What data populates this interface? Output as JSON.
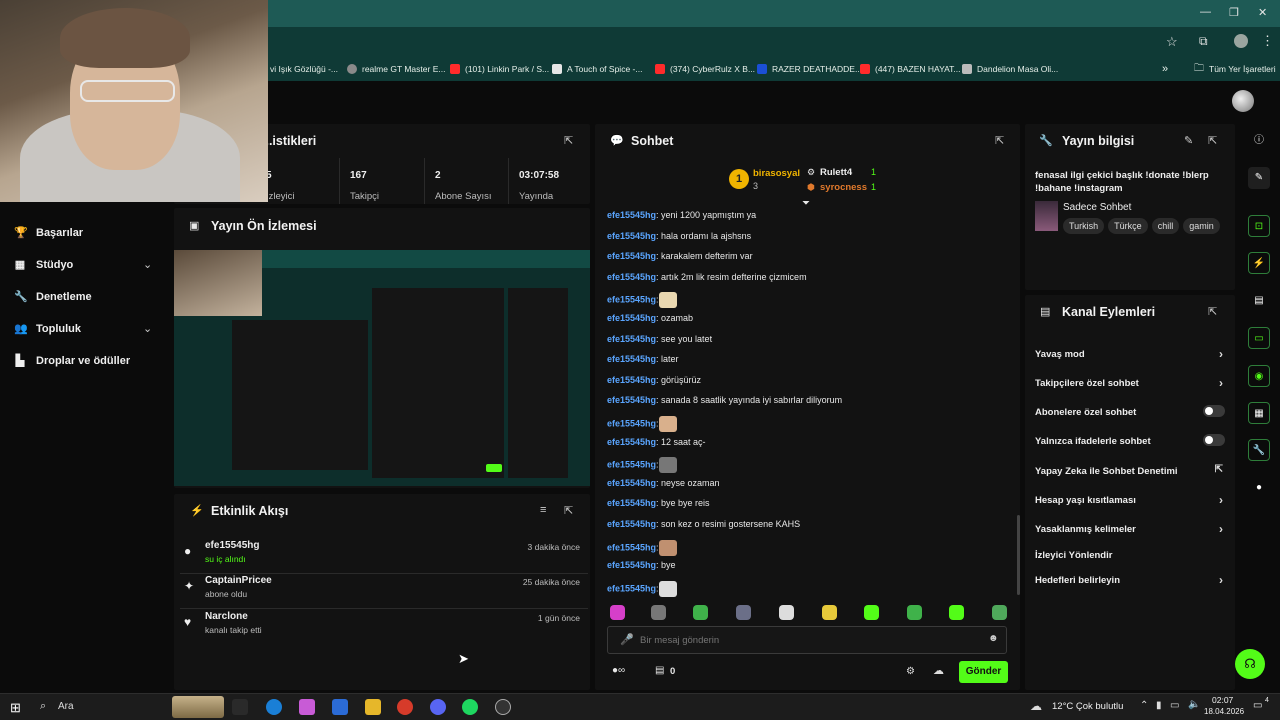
{
  "browser": {
    "bookmarks": [
      {
        "label": "vi Işık Gözlüğü -...",
        "color": "#d9d9d9"
      },
      {
        "label": "realme GT Master E...",
        "color": "#8a8a8a"
      },
      {
        "label": "(101) Linkin Park / S...",
        "color": "#ff2b2b"
      },
      {
        "label": "A Touch of Spice -...",
        "color": "#e6e6e6"
      },
      {
        "label": "(374) CyberRulz X B...",
        "color": "#ff2b2b"
      },
      {
        "label": "RAZER DEATHADDE...",
        "color": "#1b4fd6"
      },
      {
        "label": "(447) BAZEN HAYAT...",
        "color": "#ff2b2b"
      },
      {
        "label": "Dandelion Masa Oli...",
        "color": "#bbbbbb"
      }
    ],
    "overflow": "»",
    "all_bookmarks": "Tüm Yer İşaretleri"
  },
  "sidebar": {
    "items": [
      {
        "label": "Başarılar",
        "icon": "trophy-icon",
        "chevron": false
      },
      {
        "label": "Stüdyo",
        "icon": "studio-icon",
        "chevron": true
      },
      {
        "label": "Denetleme",
        "icon": "wrench-icon",
        "chevron": false
      },
      {
        "label": "Topluluk",
        "icon": "community-icon",
        "chevron": true
      },
      {
        "label": "Droplar ve ödüller",
        "icon": "drops-icon",
        "chevron": false
      }
    ]
  },
  "stats": {
    "title": "...istikleri",
    "cells": [
      {
        "value": "5",
        "label": "İzleyici"
      },
      {
        "value": "167",
        "label": "Takipçi"
      },
      {
        "value": "2",
        "label": "Abone Sayısı"
      },
      {
        "value": "03:07:58",
        "label": "Yayında"
      }
    ]
  },
  "preview": {
    "title": "Yayın Ön İzlemesi"
  },
  "activity": {
    "title": "Etkinlik Akışı",
    "events": [
      {
        "name": "efe15545hg",
        "desc": "su iç alındı",
        "time": "3 dakika önce",
        "icon": "drops-icon",
        "highlight": true
      },
      {
        "name": "CaptainPricee",
        "desc": "abone oldu",
        "time": "25 dakika önce",
        "icon": "sparkle-icon",
        "highlight": false
      },
      {
        "name": "Narclone",
        "desc": "kanalı takip etti",
        "time": "1 gün önce",
        "icon": "heart-icon",
        "highlight": false
      }
    ]
  },
  "chat": {
    "title": "Sohbet",
    "leaderboard": {
      "first": {
        "rank": "1",
        "user": "birasosyal",
        "count": "3"
      },
      "second": {
        "user": "Rulett4",
        "count": "1"
      },
      "third": {
        "user": "syrocness",
        "count": "1"
      }
    },
    "messages": [
      {
        "user": "efe15545hg",
        "text": ": yeni 1200 yapmıştım ya",
        "emote": false
      },
      {
        "user": "efe15545hg",
        "text": ": hala ordamı la ajshsns",
        "emote": false
      },
      {
        "user": "efe15545hg",
        "text": ": karakalem defterim var",
        "emote": false
      },
      {
        "user": "efe15545hg",
        "text": ": artık 2m lik resim defterine çizmicem",
        "emote": false
      },
      {
        "user": "efe15545hg",
        "text": ":",
        "emote": true
      },
      {
        "user": "efe15545hg",
        "text": ": ozamab",
        "emote": false
      },
      {
        "user": "efe15545hg",
        "text": ": see you latet",
        "emote": false
      },
      {
        "user": "efe15545hg",
        "text": ": later",
        "emote": false
      },
      {
        "user": "efe15545hg",
        "text": ": görüşürüz",
        "emote": false
      },
      {
        "user": "efe15545hg",
        "text": ": sanada 8 saatlik yayında iyi sabırlar diliyorum",
        "emote": false
      },
      {
        "user": "efe15545hg",
        "text": ":",
        "emote": true
      },
      {
        "user": "efe15545hg",
        "text": ": 12 saat aç-",
        "emote": false
      },
      {
        "user": "efe15545hg",
        "text": ":",
        "emote": true
      },
      {
        "user": "efe15545hg",
        "text": ": neyse ozaman",
        "emote": false
      },
      {
        "user": "efe15545hg",
        "text": ": bye bye reis",
        "emote": false
      },
      {
        "user": "efe15545hg",
        "text": ": son kez o resimi gostersene KAHS",
        "emote": false
      },
      {
        "user": "efe15545hg",
        "text": ":",
        "emote": true
      },
      {
        "user": "efe15545hg",
        "text": ": bye",
        "emote": false
      },
      {
        "user": "efe15545hg",
        "text": ":",
        "emote": true
      }
    ],
    "input_placeholder": "Bir mesaj gönderin",
    "points": "0",
    "send_label": "Gönder"
  },
  "stream_info": {
    "title": "Yayın bilgisi",
    "stream_title": "fenasal ilgi çekici başlık !donate !blerp !bahane !instagram",
    "category": "Sadece Sohbet",
    "tags": [
      "Turkish",
      "Türkçe",
      "chill",
      "gamin"
    ]
  },
  "channel_actions": {
    "title": "Kanal Eylemleri",
    "items": [
      {
        "label": "Yavaş mod",
        "control": "arrow"
      },
      {
        "label": "Takipçilere özel sohbet",
        "control": "arrow"
      },
      {
        "label": "Abonelere özel sohbet",
        "control": "toggle"
      },
      {
        "label": "Yalnızca ifadelerle sohbet",
        "control": "toggle"
      },
      {
        "label": "Yapay Zeka ile Sohbet Denetimi",
        "control": "external"
      },
      {
        "label": "Hesap yaşı kısıtlaması",
        "control": "arrow"
      },
      {
        "label": "Yasaklanmış kelimeler",
        "control": "arrow"
      },
      {
        "label": "İzleyici Yönlendir",
        "control": "none"
      },
      {
        "label": "Hedefleri belirleyin",
        "control": "arrow"
      }
    ]
  },
  "taskbar": {
    "search": "Ara",
    "weather": "12°C  Çok bulutlu",
    "time": "02:07",
    "date": "18.04.2026",
    "notifications": "4"
  },
  "colors": {
    "accent": "#53fc18",
    "user": "#5aa5ff",
    "panel": "#121212"
  }
}
